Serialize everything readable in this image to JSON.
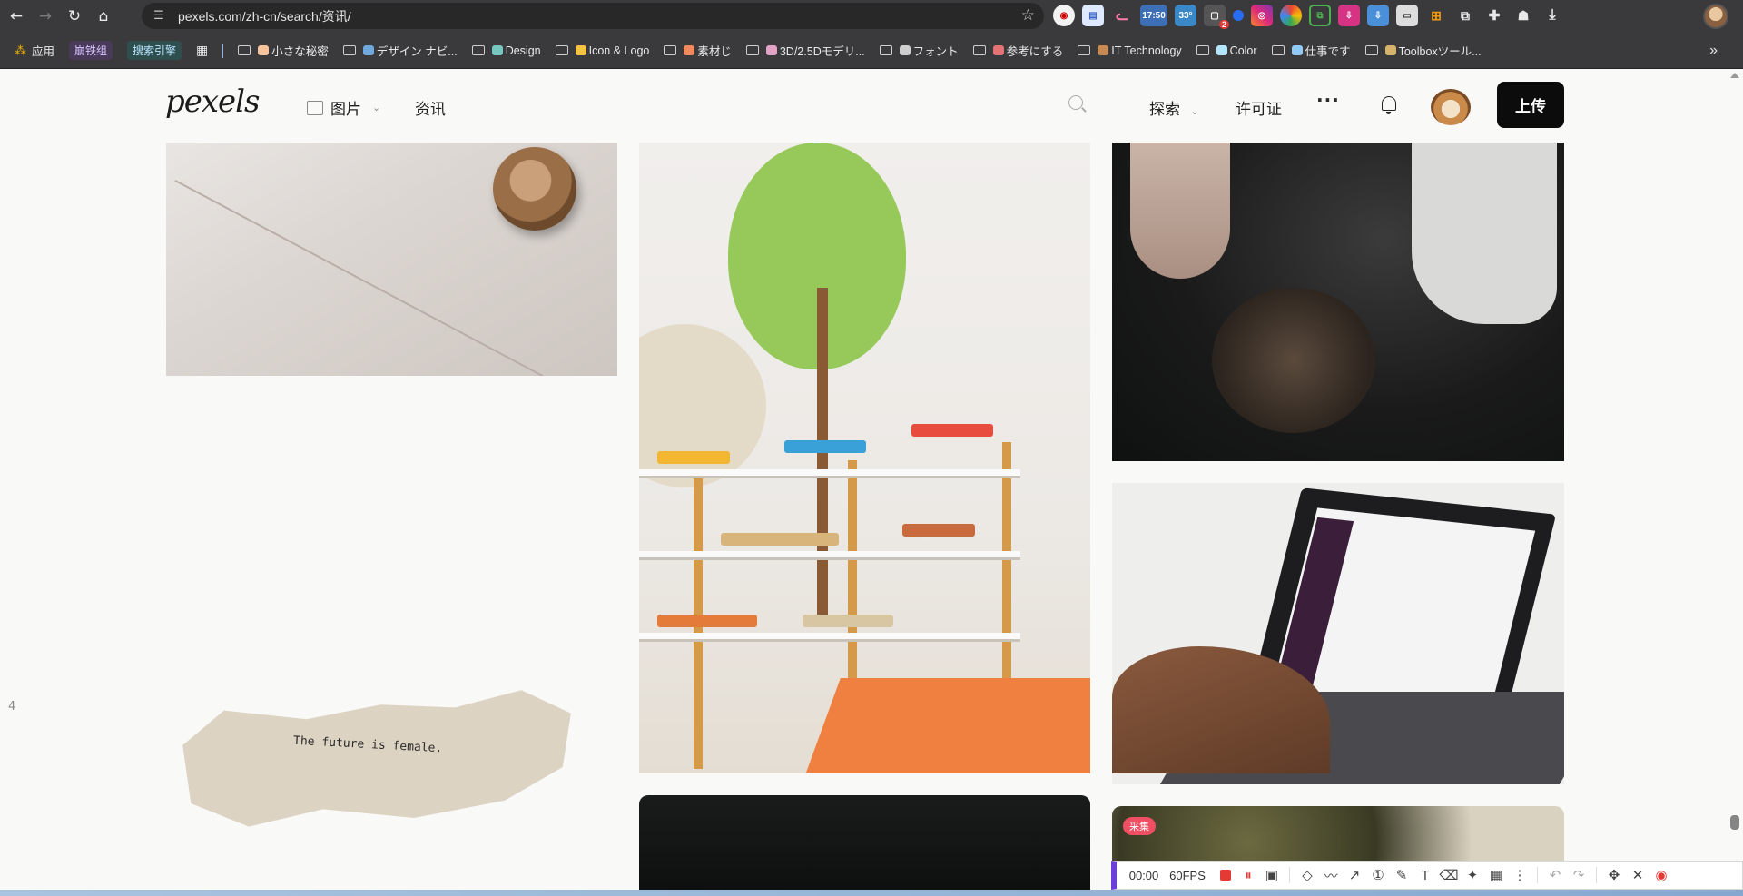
{
  "browser": {
    "url": "pexels.com/zh-cn/search/资讯/",
    "badges": {
      "ext_time": "17:50",
      "ext_temp": "33°",
      "ext_count": "2"
    },
    "bookmarks": [
      {
        "label": "应用",
        "type": "apps"
      },
      {
        "label": "崩铁组",
        "type": "pill",
        "bg": "#4a3a5a",
        "fg": "#d9c6ff"
      },
      {
        "label": "搜索引擎",
        "type": "pill",
        "bg": "#2f4f4f",
        "fg": "#b8e6ff"
      },
      {
        "label": "",
        "type": "grid"
      },
      {
        "label": "小さな秘密",
        "type": "folder",
        "emoji": "#f6c39a"
      },
      {
        "label": "デザイン ナビ...",
        "type": "folder",
        "emoji": "#6fa8dc"
      },
      {
        "label": "Design",
        "type": "folder",
        "emoji": "#76c7c0"
      },
      {
        "label": "Icon & Logo",
        "type": "folder",
        "emoji": "#f5c542"
      },
      {
        "label": "素材じ",
        "type": "folder",
        "emoji": "#f08a5d"
      },
      {
        "label": "3D/2.5Dモデリ...",
        "type": "folder",
        "emoji": "#e2a3c7"
      },
      {
        "label": "フォント",
        "type": "folder",
        "emoji": "#cfcfcf"
      },
      {
        "label": "参考にする",
        "type": "folder",
        "emoji": "#e57373"
      },
      {
        "label": "IT Technology",
        "type": "folder",
        "emoji": "#c78a52"
      },
      {
        "label": "Color",
        "type": "folder",
        "emoji": "#b3e5fc"
      },
      {
        "label": "仕事です",
        "type": "folder",
        "emoji": "#90caf9"
      },
      {
        "label": "Toolboxツール...",
        "type": "folder",
        "emoji": "#d7b26b"
      }
    ],
    "bookmarks_more": "»"
  },
  "site": {
    "logo": "pexels",
    "nav": {
      "photos": "图片",
      "news": "资讯"
    },
    "right": {
      "explore": "探索",
      "license": "许可证",
      "more": "···",
      "upload": "上传"
    }
  },
  "grid": {
    "paper_quote": "The future is female.",
    "collect_tag": "采集"
  },
  "page_number": "4",
  "recorder": {
    "time": "00:00",
    "fps": "60FPS",
    "tools": [
      "shape-icon",
      "pen-path-icon",
      "arrow-icon",
      "number-icon",
      "pencil-icon",
      "text-icon",
      "eraser-icon",
      "highlighter-icon",
      "mosaic-icon",
      "more-icon",
      "undo-icon",
      "redo-icon",
      "move-icon",
      "close-icon",
      "record-icon"
    ]
  }
}
